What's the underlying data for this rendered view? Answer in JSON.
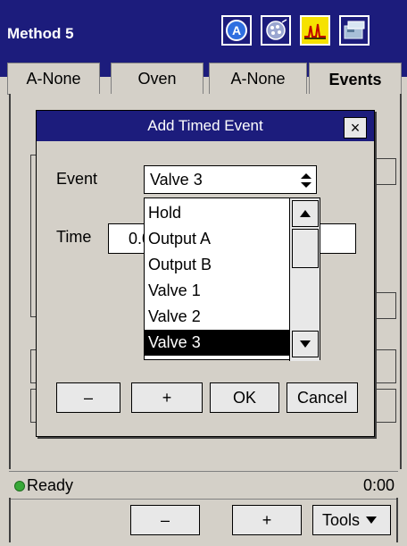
{
  "app": {
    "title": "Method 5",
    "tabs": [
      "A-None",
      "Oven",
      "A-None",
      "Events"
    ],
    "active_tab": "Events"
  },
  "dialog": {
    "title": "Add Timed Event",
    "close_label": "×",
    "event_label": "Event",
    "event_value": "Valve 3",
    "time_label": "Time",
    "time_value": "0.0",
    "dropdown_options": [
      "Hold",
      "Output A",
      "Output B",
      "Valve 1",
      "Valve 2",
      "Valve 3"
    ],
    "selected_option": "Valve 3",
    "buttons": {
      "minus": "–",
      "plus": "+",
      "ok": "OK",
      "cancel": "Cancel"
    }
  },
  "status": {
    "text": "Ready",
    "time": "0:00",
    "indicator_color": "#38a838"
  },
  "toolbar": {
    "minus": "–",
    "plus": "+",
    "tools": "Tools"
  },
  "colors": {
    "titlebar": "#1c1c7c",
    "panel": "#d4d0c8",
    "selection": "#000000"
  },
  "icons": [
    "autosampler-icon",
    "detector-icon",
    "chromatogram-icon",
    "instrument-icon"
  ]
}
